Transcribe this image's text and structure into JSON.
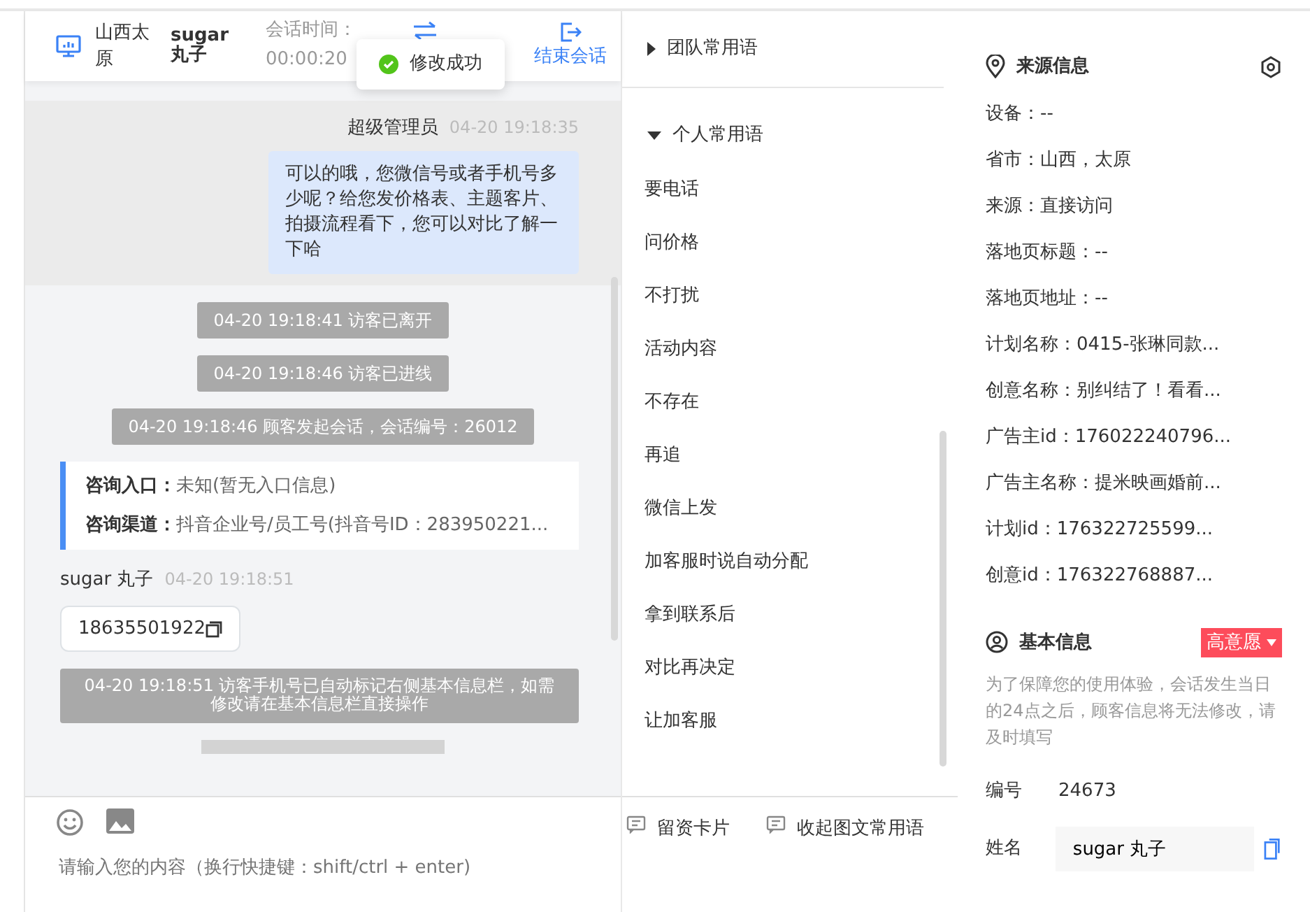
{
  "header": {
    "location": "山西太原",
    "visitor": "sugar 丸子",
    "time_label": "会话时间：",
    "time_value": "00:00:20",
    "end_button": "结束会话"
  },
  "toast": {
    "text": "修改成功"
  },
  "messages": [
    {
      "kind": "agent",
      "name": "超级管理员",
      "time": "04-20 19:18:35",
      "text": "可以的哦，您微信号或者手机号多少呢？给您发价格表、主题客片、拍摄流程看下，您可以对比了解一下哈"
    },
    {
      "kind": "system",
      "text": "04-20 19:18:41 访客已离开"
    },
    {
      "kind": "system",
      "text": "04-20 19:18:46 访客已进线"
    },
    {
      "kind": "system",
      "text": "04-20 19:18:46 顾客发起会话，会话编号：26012"
    },
    {
      "kind": "info_card",
      "rows": [
        {
          "label": "咨询入口：",
          "value": "未知(暂无入口信息)"
        },
        {
          "label": "咨询渠道：",
          "value": "抖音企业号/员工号(抖音号ID：283950221..."
        }
      ]
    },
    {
      "kind": "visitor",
      "name": "sugar 丸子",
      "time": "04-20 19:18:51",
      "phone": "18635501922"
    },
    {
      "kind": "system",
      "text": "04-20 19:18:51 访客手机号已自动标记右侧基本信息栏，如需修改请在基本信息栏直接操作"
    }
  ],
  "composer": {
    "placeholder": "请输入您的内容（换行快捷键：shift/ctrl + enter)"
  },
  "quick_replies": {
    "groups": [
      {
        "title": "团队常用语",
        "expanded": false
      },
      {
        "title": "个人常用语",
        "expanded": true,
        "items": [
          "要电话",
          "问价格",
          "不打扰",
          "活动内容",
          "不存在",
          "再追",
          "微信上发",
          "加客服时说自动分配",
          "拿到联系后",
          "对比再决定",
          "让加客服"
        ]
      }
    ],
    "buttons": [
      "留资卡片",
      "收起图文常用语"
    ]
  },
  "source_info": {
    "title": "来源信息",
    "rows": [
      "设备：--",
      "省市：山西，太原",
      "来源：直接访问",
      "落地页标题：--",
      "落地页地址：--",
      "计划名称：0415-张琳同款...",
      "创意名称：别纠结了！看看...",
      "广告主id：176022240796...",
      "广告主名称：提米映画婚前...",
      "计划id：176322725599...",
      "创意id：176322768887..."
    ]
  },
  "basic_info": {
    "title": "基本信息",
    "tag": "高意愿",
    "note": "为了保障您的使用体验，会话发生当日的24点之后，顾客信息将无法修改，请及时填写",
    "fields": [
      {
        "kind": "text",
        "label": "编号",
        "value": "24673"
      },
      {
        "kind": "input",
        "label": "姓名",
        "value": "sugar 丸子"
      }
    ]
  }
}
